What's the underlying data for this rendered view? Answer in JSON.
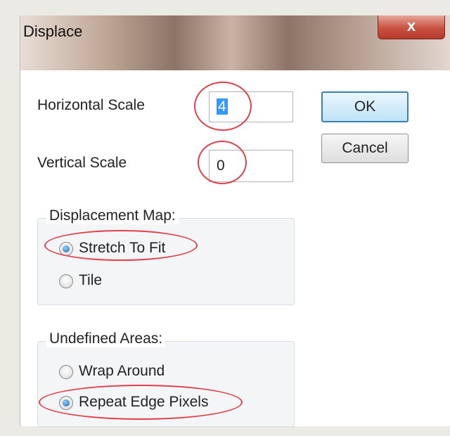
{
  "dialog": {
    "title": "Displace",
    "close_glyph": "x"
  },
  "fields": {
    "horizontal_scale_label": "Horizontal Scale",
    "horizontal_scale_value": "4",
    "vertical_scale_label": "Vertical Scale",
    "vertical_scale_value": "0"
  },
  "buttons": {
    "ok_label": "OK",
    "cancel_label": "Cancel"
  },
  "displacement_map": {
    "legend": "Displacement Map:",
    "options": [
      {
        "label": "Stretch To Fit",
        "checked": true
      },
      {
        "label": "Tile",
        "checked": false
      }
    ]
  },
  "undefined_areas": {
    "legend": "Undefined Areas:",
    "options": [
      {
        "label": "Wrap Around",
        "checked": false
      },
      {
        "label": "Repeat Edge Pixels",
        "checked": true
      }
    ]
  },
  "annotation_color": "#e0404a"
}
